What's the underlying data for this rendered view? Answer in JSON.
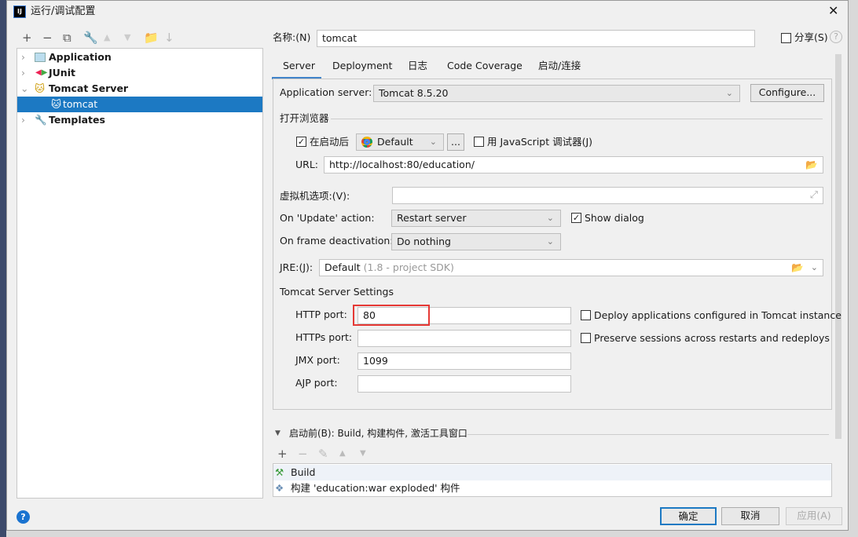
{
  "window": {
    "title": "运行/调试配置",
    "logo": "IJ"
  },
  "tree": {
    "items": [
      {
        "label": "Application",
        "icon": "application-icon",
        "expanded": false
      },
      {
        "label": "JUnit",
        "icon": "junit-icon",
        "expanded": false
      },
      {
        "label": "Tomcat Server",
        "icon": "tomcat-icon",
        "expanded": true
      },
      {
        "label": "tomcat",
        "icon": "tomcat-icon",
        "selected": true
      },
      {
        "label": "Templates",
        "icon": "wrench-icon",
        "expanded": false
      }
    ]
  },
  "name": {
    "label": "名称:(N)",
    "value": "tomcat"
  },
  "share": {
    "label": "分享(S)",
    "checked": false
  },
  "tabs": [
    "Server",
    "Deployment",
    "日志",
    "Code Coverage",
    "启动/连接"
  ],
  "server": {
    "app_server_label": "Application server:",
    "app_server_value": "Tomcat 8.5.20",
    "configure": "Configure...",
    "browser_section": "打开浏览器",
    "after_launch_label": "在启动后",
    "after_launch_checked": true,
    "browser_value": "Default",
    "more": "...",
    "js_debugger_label": "用 JavaScript 调试器(J)",
    "js_debugger_checked": false,
    "url_label": "URL:",
    "url_value": "http://localhost:80/education/",
    "vm_label": "虚拟机选项:(V):",
    "vm_value": "",
    "update_label": "On 'Update' action:",
    "update_value": "Restart server",
    "show_dialog_label": "Show dialog",
    "show_dialog_checked": true,
    "frame_label": "On frame deactivation:",
    "frame_value": "Do nothing",
    "jre_label": "JRE:(J):",
    "jre_value": "Default",
    "jre_hint": "(1.8 - project SDK)",
    "tomcat_section": "Tomcat Server Settings",
    "http_label": "HTTP port:",
    "http_value": "80",
    "https_label": "HTTPs port:",
    "https_value": "",
    "jmx_label": "JMX port:",
    "jmx_value": "1099",
    "ajp_label": "AJP port:",
    "ajp_value": "",
    "deploy_label": "Deploy applications configured in Tomcat instance",
    "preserve_label": "Preserve sessions across restarts and redeploys"
  },
  "before_launch": {
    "title": "启动前(B): Build, 构建构件, 激活工具窗口",
    "items": [
      "Build",
      "构建 'education:war exploded' 构件"
    ]
  },
  "buttons": {
    "ok": "确定",
    "cancel": "取消",
    "apply": "应用(A)"
  },
  "colors": {
    "selection": "#1c79c3",
    "highlight": "#e53935",
    "tab_underline": "#4083c9"
  }
}
